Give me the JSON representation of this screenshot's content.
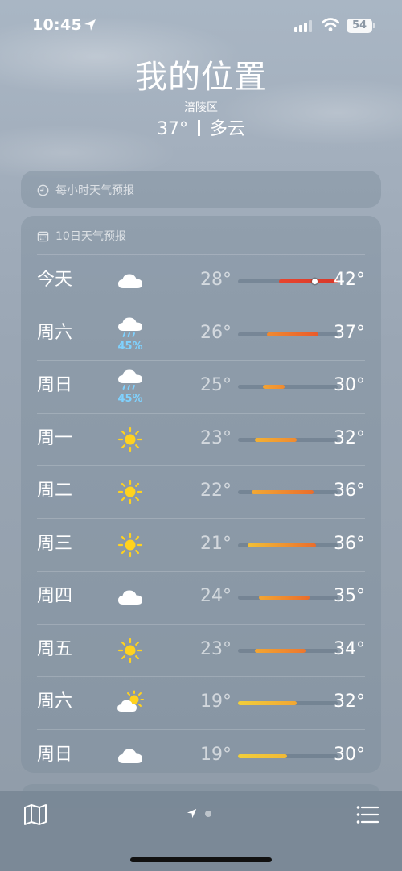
{
  "status_bar": {
    "time": "10:45",
    "battery": "54"
  },
  "header": {
    "title": "我的位置",
    "location": "涪陵区",
    "temperature": "37°",
    "condition": "多云"
  },
  "hourly": {
    "title": "每小时天气预报"
  },
  "daily": {
    "title": "10日天气预报",
    "days": [
      {
        "day": "今天",
        "icon": "cloud-icon",
        "precip": "",
        "low": "28°",
        "high": "42°",
        "bar_start": 0.41,
        "bar_end": 1.0,
        "colors": [
          "#e8452e",
          "#d8382a"
        ],
        "now": 0.77
      },
      {
        "day": "周六",
        "icon": "rain-icon",
        "precip": "45%",
        "low": "26°",
        "high": "37°",
        "bar_start": 0.29,
        "bar_end": 0.81,
        "colors": [
          "#f08a30",
          "#ea5a2a"
        ]
      },
      {
        "day": "周日",
        "icon": "rain-icon",
        "precip": "45%",
        "low": "25°",
        "high": "30°",
        "bar_start": 0.25,
        "bar_end": 0.47,
        "colors": [
          "#f3a332",
          "#f08a30"
        ]
      },
      {
        "day": "周一",
        "icon": "sun-icon",
        "precip": "",
        "low": "23°",
        "high": "32°",
        "bar_start": 0.17,
        "bar_end": 0.59,
        "colors": [
          "#f2b134",
          "#f08a30"
        ]
      },
      {
        "day": "周二",
        "icon": "sun-icon",
        "precip": "",
        "low": "22°",
        "high": "36°",
        "bar_start": 0.14,
        "bar_end": 0.76,
        "colors": [
          "#f2a934",
          "#ea6d2c"
        ]
      },
      {
        "day": "周三",
        "icon": "sun-icon",
        "precip": "",
        "low": "21°",
        "high": "36°",
        "bar_start": 0.1,
        "bar_end": 0.78,
        "colors": [
          "#f2c036",
          "#ea6d2c"
        ]
      },
      {
        "day": "周四",
        "icon": "cloud-icon",
        "precip": "",
        "low": "24°",
        "high": "35°",
        "bar_start": 0.21,
        "bar_end": 0.72,
        "colors": [
          "#f2a632",
          "#ea6d2c"
        ]
      },
      {
        "day": "周五",
        "icon": "sun-icon",
        "precip": "",
        "low": "23°",
        "high": "34°",
        "bar_start": 0.17,
        "bar_end": 0.68,
        "colors": [
          "#f2a632",
          "#ed772e"
        ]
      },
      {
        "day": "周六",
        "icon": "partly-cloudy-icon",
        "precip": "",
        "low": "19°",
        "high": "32°",
        "bar_start": 0.0,
        "bar_end": 0.59,
        "colors": [
          "#f1cf3b",
          "#f2a632"
        ]
      },
      {
        "day": "周日",
        "icon": "cloud-icon",
        "precip": "",
        "low": "19°",
        "high": "30°",
        "bar_start": 0.0,
        "bar_end": 0.49,
        "colors": [
          "#f1cf3b",
          "#f1b936"
        ]
      }
    ]
  },
  "toolbar": {
    "map_icon": "map-icon",
    "list_icon": "list-icon",
    "pages": [
      "location-page",
      "page-2"
    ]
  }
}
